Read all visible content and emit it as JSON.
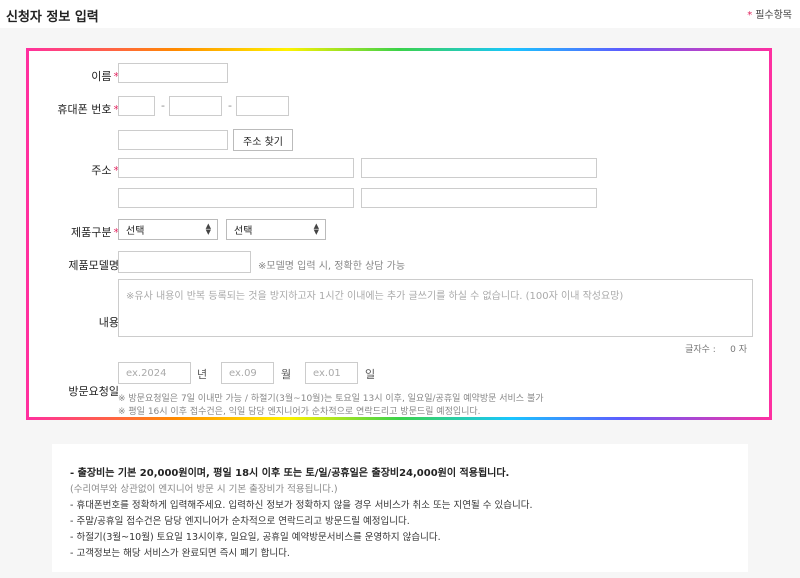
{
  "header": {
    "title": "신청자 정보 입력",
    "required_note": "필수항목"
  },
  "form": {
    "name_label": "이름",
    "phone_label": "휴대폰 번호",
    "phone_dash": "-",
    "address_label": "주소",
    "address_search_button": "주소 찾기",
    "product_label": "제품구분",
    "product_select_1": "선택",
    "product_select_2": "선택",
    "model_label": "제품모델명",
    "model_hint": "※모델명 입력 시, 정확한 상담 가능",
    "content_label": "내용",
    "content_placeholder": "※유사 내용이 반복 등록되는 것을 방지하고자 1시간 이내에는 추가 글쓰기를 하실 수 없습니다. (100자 이내 작성요망)",
    "counter_label": "글자수 :",
    "counter_value": "0 자",
    "visit_label": "방문요청일",
    "year_placeholder": "ex.2024",
    "year_unit": "년",
    "month_placeholder": "ex.09",
    "month_unit": "월",
    "day_placeholder": "ex.01",
    "day_unit": "일",
    "visit_note_1": "※ 방문요청일은 7일 이내만 가능 / 하절기(3월~10월)는 토요일 13시 이후, 일요일/공휴일 예약방문 서비스 불가",
    "visit_note_2": "※ 평일 16시 이후 접수건은, 익일 담당 엔지니어가 순차적으로 연락드리고 방문드릴 예정입니다."
  },
  "notice": {
    "line1": "-  출장비는 기본 20,000원이며, 평일 18시 이후 또는 토/일/공휴일은 출장비24,000원이 적용됩니다.",
    "line2": "(수리여부와 상관없이 엔지니어 방문 시 기본 출장비가 적용됩니다.)",
    "line3": "-  휴대폰번호를 정확하게 입력해주세요. 입력하신 정보가 정확하지 않을 경우 서비스가 취소 또는 지연될 수 있습니다.",
    "line4": "-  주말/공휴일 접수건은 담당 엔지니어가 순차적으로 연락드리고 방문드릴 예정입니다.",
    "line5": "-  하절기(3월~10월) 토요일 13시이후, 일요일, 공휴일 예약방문서비스를 운영하지 않습니다.",
    "line6": "-  고객정보는 해당 서비스가 완료되면 즉시 폐기 합니다."
  },
  "colors": {
    "required": "#e0245e",
    "frame_gradient": [
      "#ff2fa0",
      "#ff8a00",
      "#fff200",
      "#3bd24a",
      "#19c6ff",
      "#5d5cff"
    ]
  }
}
